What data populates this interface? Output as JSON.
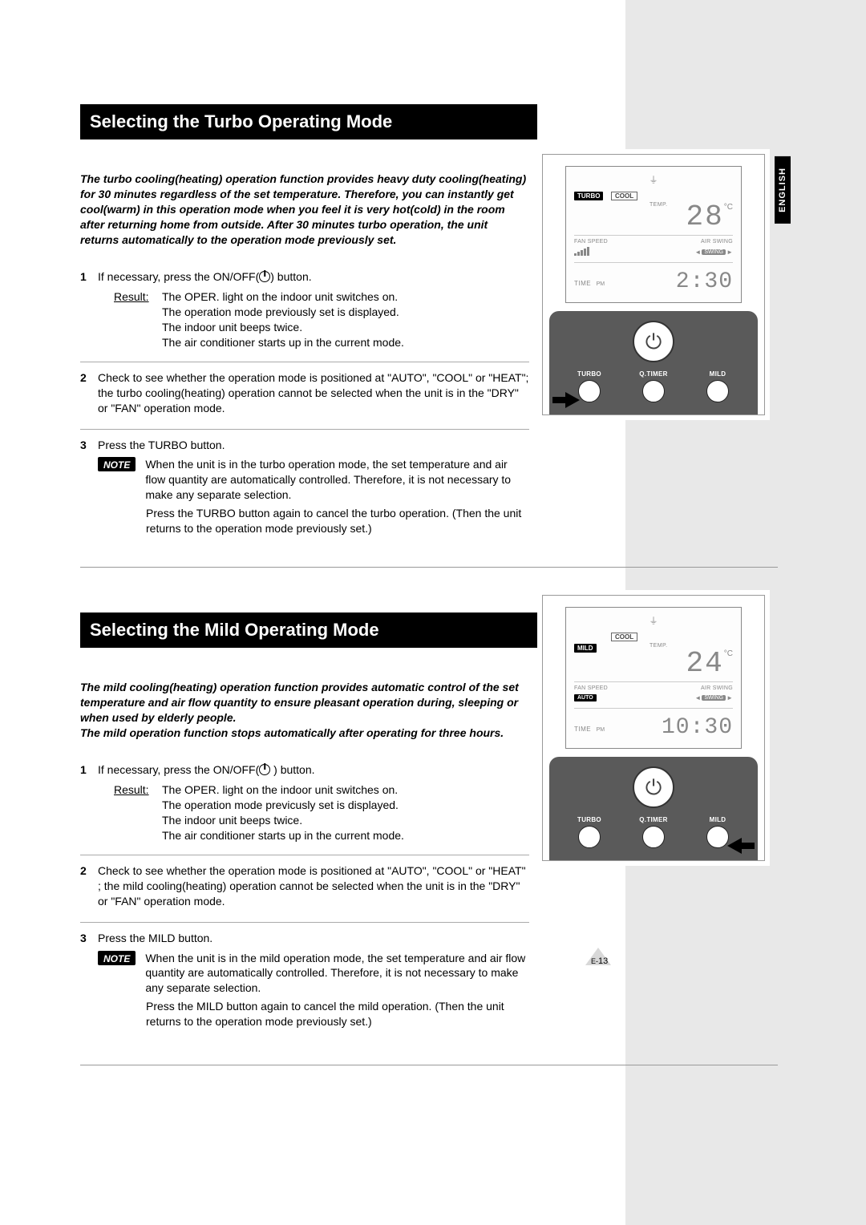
{
  "language_tag": "ENGLISH",
  "page_prefix": "E-",
  "page_number": "13",
  "sections": [
    {
      "heading": "Selecting the Turbo Operating Mode",
      "intro": "The turbo cooling(heating) operation function provides heavy duty cooling(heating) for 30 minutes regardless of the set temperature. Therefore, you can instantly get cool(warm) in this operation mode when you feel it is very hot(cold) in the room after returning home from outside. After 30 minutes turbo operation, the unit returns automatically to the operation mode previously set.",
      "steps": [
        {
          "num": "1",
          "main_pre": "If necessary, press the ON/OFF(",
          "main_post": ") button.",
          "result_label": "Result:",
          "result": "The OPER. light on the indoor unit switches on.\nThe operation mode previously set is displayed.\nThe indoor unit beeps twice.\nThe air conditioner starts up in the current mode."
        },
        {
          "num": "2",
          "main": "Check to see whether the operation mode is positioned at \"AUTO\", \"COOL\" or \"HEAT\"; the turbo cooling(heating) operation cannot be selected when the unit is in the \"DRY\" or \"FAN\" operation mode."
        },
        {
          "num": "3",
          "main": "Press the TURBO button.",
          "note_label": "NOTE",
          "note": "When the unit is in the turbo operation mode, the set temperature and air flow quantity are automatically controlled. Therefore, it is not necessary to make any separate selection.",
          "after": "Press the TURBO button again to cancel the turbo operation. (Then the unit returns to the operation mode previously set.)"
        }
      ],
      "remote": {
        "badge_left": "TURBO",
        "badge_right": "COOL",
        "temp_label": "TEMP.",
        "temp_value": "28",
        "temp_unit": "°C",
        "fan_label": "FAN SPEED",
        "swing_label": "AIR SWING",
        "swing_box": "SWING",
        "time_label": "TIME",
        "time_ampm": "PM",
        "time_value": "2:30",
        "btn1": "TURBO",
        "btn2": "Q.TIMER",
        "btn3": "MILD",
        "arrow_side": "left"
      }
    },
    {
      "heading": "Selecting the Mild Operating Mode",
      "intro": "The mild cooling(heating) operation function provides automatic control of the set temperature and air flow quantity to ensure pleasant operation during, sleeping or when used by elderly people.\nThe mild operation function stops automatically after operating for three hours.",
      "steps": [
        {
          "num": "1",
          "main_pre": "If necessary, press the ON/OFF(",
          "main_post": " ) button.",
          "result_label": "Result:",
          "result": "The OPER. light on the indoor unit switches on.\nThe operation mode previcusly set is displayed.\nThe indoor unit beeps twice.\nThe air conditioner starts up in the current mode."
        },
        {
          "num": "2",
          "main": "Check to see whether the operation mode is positioned at \"AUTO\", \"COOL\" or \"HEAT\" ; the mild cooling(heating) operation cannot be selected when the unit is in the \"DRY\" or \"FAN\" operation mode."
        },
        {
          "num": "3",
          "main": "Press the MILD button.",
          "note_label": "NOTE",
          "note": "When the unit is in the mild operation mode, the set temperature and air flow quantity are automatically controlled. Therefore, it is not necessary to make any separate selection.",
          "after": "Press the MILD button again to cancel the mild operation. (Then the unit returns to the operation mode previously set.)"
        }
      ],
      "remote": {
        "badge_left": "MILD",
        "badge_right": "COOL",
        "temp_label": "TEMP.",
        "temp_value": "24",
        "temp_unit": "°C",
        "fan_label": "FAN SPEED",
        "swing_label": "AIR SWING",
        "auto_text": "AUTO",
        "swing_box": "SWING",
        "time_label": "TIME",
        "time_ampm": "PM",
        "time_value": "10:30",
        "btn1": "TURBO",
        "btn2": "Q.TIMER",
        "btn3": "MILD",
        "arrow_side": "right"
      }
    }
  ]
}
